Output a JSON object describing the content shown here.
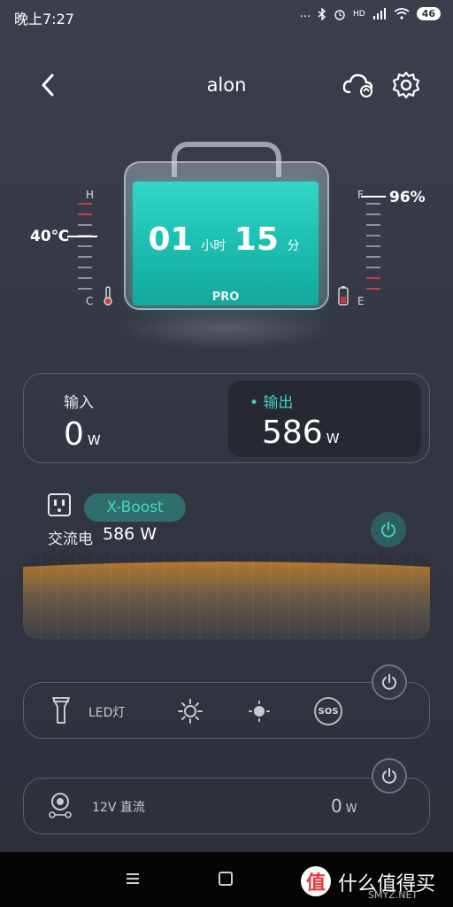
{
  "status_bar": {
    "time": "晚上7:27",
    "signal_text": "...",
    "network_label": "HD",
    "battery_level": "46"
  },
  "header": {
    "title": "alon",
    "back_icon": "chevron-left-icon",
    "cloud_icon": "cloud-sync-icon",
    "settings_icon": "gear-icon"
  },
  "device": {
    "runtime_hours": "01",
    "hours_unit": "小时",
    "runtime_minutes": "15",
    "minutes_unit": "分",
    "model_label": "PRO",
    "screen_color": "#1ec1b4"
  },
  "temperature_gauge": {
    "value_label": "40℃",
    "top_letter": "H",
    "bottom_letter": "C",
    "icon": "thermometer-icon"
  },
  "battery_gauge": {
    "value_label": "96%",
    "top_letter": "F",
    "bottom_letter": "E",
    "icon": "battery-icon"
  },
  "power": {
    "input_title": "输入",
    "input_value": "0",
    "input_unit": "W",
    "output_title": "• 输出",
    "output_value": "586",
    "output_unit": "W"
  },
  "ac": {
    "outlet_icon": "ac-outlet-icon",
    "boost_label": "X-Boost",
    "label": "交流电",
    "value": "586 W",
    "power_icon": "power-icon"
  },
  "led": {
    "label": "LED灯",
    "sos_label": "SOS",
    "icons": [
      "flashlight-icon",
      "sun-bright-icon",
      "sun-dim-icon",
      "sos-icon",
      "power-icon"
    ]
  },
  "dc": {
    "label": "12V 直流",
    "value": "0",
    "unit": "W",
    "icons": [
      "car-socket-icon",
      "power-icon"
    ]
  },
  "nav_bar": {
    "icons": [
      "menu-icon",
      "home-square-icon"
    ]
  },
  "watermark": {
    "logo_char": "值",
    "text": "什么值得买",
    "sub": "SMYZ.NET"
  },
  "colors": {
    "accent": "#3fd1c4",
    "background": "#353944",
    "chart_orange": "#b0772f",
    "gauge_red": "#d03a3a"
  }
}
